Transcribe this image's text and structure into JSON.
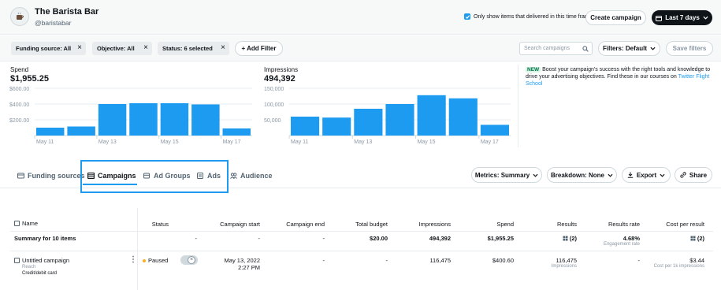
{
  "account": {
    "name": "The Barista Bar",
    "handle": "@baristabar"
  },
  "header": {
    "checkbox_label": "Only show items that delivered in this time frame",
    "checkbox_checked": true,
    "create_campaign": "Create campaign",
    "date_range": "Last 7 days"
  },
  "filters": {
    "chips": [
      "Funding source: All",
      "Objective: All",
      "Status: 6 selected"
    ],
    "add_filter": "+ Add Filter",
    "search_placeholder": "Search campaigns",
    "filters_default": "Filters: Default",
    "save_filters": "Save filters"
  },
  "promo": {
    "badge": "NEW",
    "text": "Boost your campaign's success with the right tools and knowledge to drive your advertising objectives. Find these in our courses on",
    "link": "Twitter Flight School"
  },
  "chart_data": [
    {
      "type": "bar",
      "title": "Spend",
      "total": "$1,955.25",
      "y_ticks": [
        "$600.00",
        "$400.00",
        "$200.00"
      ],
      "ylim": [
        0,
        600
      ],
      "x_ticks": [
        "May 11",
        "May 13",
        "May 15",
        "May 17"
      ],
      "categories": [
        "May 11",
        "May 12",
        "May 13",
        "May 14",
        "May 15",
        "May 16",
        "May 17"
      ],
      "values": [
        100,
        115,
        400,
        410,
        410,
        395,
        90
      ],
      "color": "#1d9bf0"
    },
    {
      "type": "bar",
      "title": "Impressions",
      "total": "494,392",
      "y_ticks": [
        "150,000",
        "100,000",
        "50,000"
      ],
      "ylim": [
        0,
        150000
      ],
      "x_ticks": [
        "May 11",
        "May 13",
        "May 15",
        "May 17"
      ],
      "categories": [
        "May 11",
        "May 12",
        "May 13",
        "May 14",
        "May 15",
        "May 16",
        "May 17"
      ],
      "values": [
        60000,
        57000,
        85000,
        100000,
        128000,
        118000,
        34000
      ],
      "color": "#1d9bf0"
    }
  ],
  "tabs": [
    {
      "label": "Funding sources",
      "icon": "card-icon"
    },
    {
      "label": "Campaigns",
      "icon": "campaign-icon",
      "active": true
    },
    {
      "label": "Ad Groups",
      "icon": "adgroup-icon"
    },
    {
      "label": "Ads",
      "icon": "ad-icon"
    },
    {
      "label": "Audience",
      "icon": "people-icon"
    }
  ],
  "toolbar": {
    "metrics": "Metrics: Summary",
    "breakdown": "Breakdown: None",
    "export": "Export",
    "share": "Share"
  },
  "table": {
    "headers": {
      "name": "Name",
      "status": "Status",
      "start": "Campaign start",
      "end": "Campaign end",
      "budget": "Total budget",
      "impressions": "Impressions",
      "spend": "Spend",
      "results": "Results",
      "rate": "Results rate",
      "cpr": "Cost per result"
    },
    "summary": {
      "name": "Summary for 10 items",
      "status": "-",
      "start": "-",
      "end": "-",
      "budget": "$20.00",
      "impressions": "494,392",
      "spend": "$1,955.25",
      "results": "(2)",
      "rate": "4.68%",
      "rate_sub": "Engagement rate",
      "cpr": "(2)"
    },
    "row": {
      "name": "Untitled campaign",
      "objective": "Reach",
      "funding": "Credit/debit card",
      "status": "Paused",
      "start": "May 13, 2022",
      "start_time": "2:27 PM",
      "end": "-",
      "budget": "-",
      "impressions": "116,475",
      "spend": "$400.60",
      "results": "116,475",
      "results_sub": "Impressions",
      "rate": "-",
      "cpr": "$3.44",
      "cpr_sub": "Cost per 1k impressions"
    }
  }
}
